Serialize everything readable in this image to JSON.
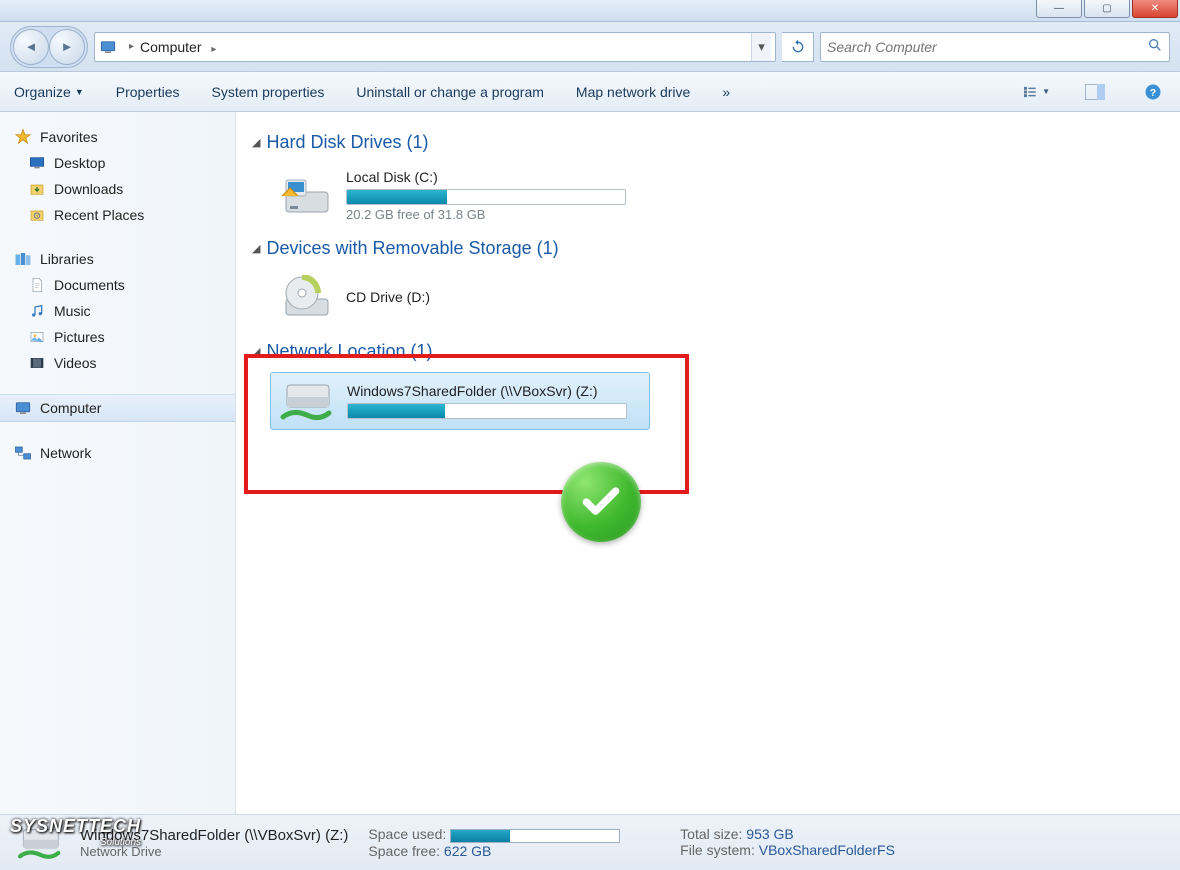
{
  "window": {
    "controls": {
      "minimize": "—",
      "maximize": "▢",
      "close": "✕"
    }
  },
  "addressbar": {
    "location": "Computer",
    "chevron": "▸"
  },
  "search": {
    "placeholder": "Search Computer"
  },
  "toolbar": {
    "organize": "Organize",
    "properties": "Properties",
    "system_properties": "System properties",
    "uninstall": "Uninstall or change a program",
    "map_drive": "Map network drive",
    "more": "»"
  },
  "sidebar": {
    "favorites": {
      "label": "Favorites",
      "items": [
        "Desktop",
        "Downloads",
        "Recent Places"
      ]
    },
    "libraries": {
      "label": "Libraries",
      "items": [
        "Documents",
        "Music",
        "Pictures",
        "Videos"
      ]
    },
    "computer": {
      "label": "Computer"
    },
    "network": {
      "label": "Network"
    }
  },
  "sections": {
    "hdd": {
      "title": "Hard Disk Drives (1)",
      "drive": {
        "name": "Local Disk (C:)",
        "free_text": "20.2 GB free of 31.8 GB",
        "used_pct": 36
      }
    },
    "removable": {
      "title": "Devices with Removable Storage (1)",
      "drive": {
        "name": "CD Drive (D:)"
      }
    },
    "network": {
      "title": "Network Location (1)",
      "drive": {
        "name": "Windows7SharedFolder (\\\\VBoxSvr) (Z:)",
        "used_pct": 35
      }
    }
  },
  "details": {
    "title": "Windows7SharedFolder (\\\\VBoxSvr) (Z:)",
    "subtitle": "Network Drive",
    "space_used_label": "Space used:",
    "space_free_label": "Space free:",
    "space_free_value": "622 GB",
    "total_size_label": "Total size:",
    "total_size_value": "953 GB",
    "file_system_label": "File system:",
    "file_system_value": "VBoxSharedFolderFS"
  },
  "watermark": {
    "line1": "SYSNETTECH",
    "line2": "Solutions"
  }
}
